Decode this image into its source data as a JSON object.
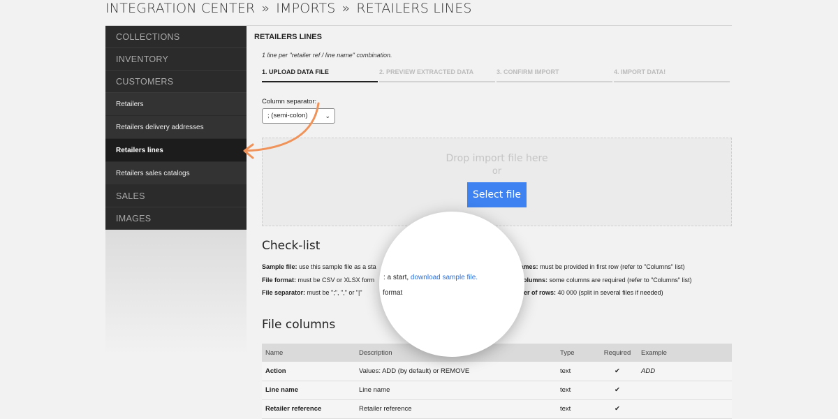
{
  "breadcrumb": {
    "parts": [
      "INTEGRATION CENTER",
      "IMPORTS",
      "RETAILERS LINES"
    ],
    "separator": "»"
  },
  "sidebar": {
    "collections": "COLLECTIONS",
    "inventory": "INVENTORY",
    "customers": "CUSTOMERS",
    "sub_items": [
      "Retailers",
      "Retailers delivery addresses",
      "Retailers lines",
      "Retailers sales catalogs"
    ],
    "active_item": "Retailers lines",
    "sales": "SALES",
    "images": "IMAGES"
  },
  "main": {
    "title": "RETAILERS LINES",
    "hint": "1 line per \"retailer ref / line name\" combination.",
    "steps": [
      "1. UPLOAD DATA FILE",
      "2. PREVIEW EXTRACTED DATA",
      "3. CONFIRM IMPORT",
      "4. IMPORT DATA!"
    ],
    "separator_label": "Column separator:",
    "separator_value": "; (semi-colon)",
    "drop_text": "Drop import file here",
    "drop_or": "or",
    "select_file": "Select file"
  },
  "checklist": {
    "title": "Check-list",
    "sample_label": "Sample file:",
    "sample_text": "use this sample file as a sta",
    "format_label": "File format:",
    "format_text": "must be CSV or XLSX form",
    "separator_label": "File separator:",
    "separator_text": "must be \";\", \",\" or \"|\"",
    "names_label": "n names:",
    "names_text": "must be provided in first row (refer to \"Columns\" list)",
    "required_label": "ed columns:",
    "required_text": "some columns are required (refer to \"Columns\" list)",
    "rows_label": "umber of rows:",
    "rows_text": "40 000 (split in several files if needed)"
  },
  "magnifier": {
    "prefix": ": a start,",
    "link": "download sample file.",
    "line2": "format"
  },
  "file_columns": {
    "title": "File columns",
    "headers": [
      "Name",
      "Description",
      "Type",
      "Required",
      "Example"
    ],
    "rows": [
      {
        "name": "Action",
        "description": "Values: ADD (by default) or REMOVE",
        "type": "text",
        "required": "✔",
        "example": "ADD"
      },
      {
        "name": "Line name",
        "description": "Line name",
        "type": "text",
        "required": "✔",
        "example": ""
      },
      {
        "name": "Retailer reference",
        "description": "Retailer reference",
        "type": "text",
        "required": "✔",
        "example": ""
      }
    ]
  },
  "colors": {
    "accent": "#3d82f0",
    "sidebar": "#2b2b2b",
    "arrow": "#f0935a",
    "link": "#2a6fdc"
  }
}
